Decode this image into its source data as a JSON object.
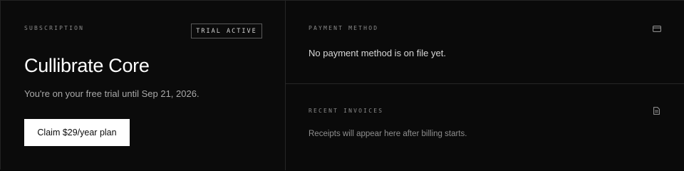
{
  "subscription": {
    "eyebrow": "SUBSCRIPTION",
    "badge": "TRIAL ACTIVE",
    "plan_name": "Cullibrate Core",
    "trial_message": "You're on your free trial until Sep 21, 2026.",
    "cta_label": "Claim $29/year plan"
  },
  "payment": {
    "eyebrow": "PAYMENT METHOD",
    "icon": "credit-card-icon",
    "message": "No payment method is on file yet."
  },
  "invoices": {
    "eyebrow": "RECENT INVOICES",
    "icon": "document-icon",
    "message": "Receipts will appear here after billing starts."
  },
  "colors": {
    "background": "#0b0b0b",
    "border": "#262626",
    "button_bg": "#ffffff",
    "button_text": "#0b0b0b",
    "muted": "#8a8a8a"
  }
}
